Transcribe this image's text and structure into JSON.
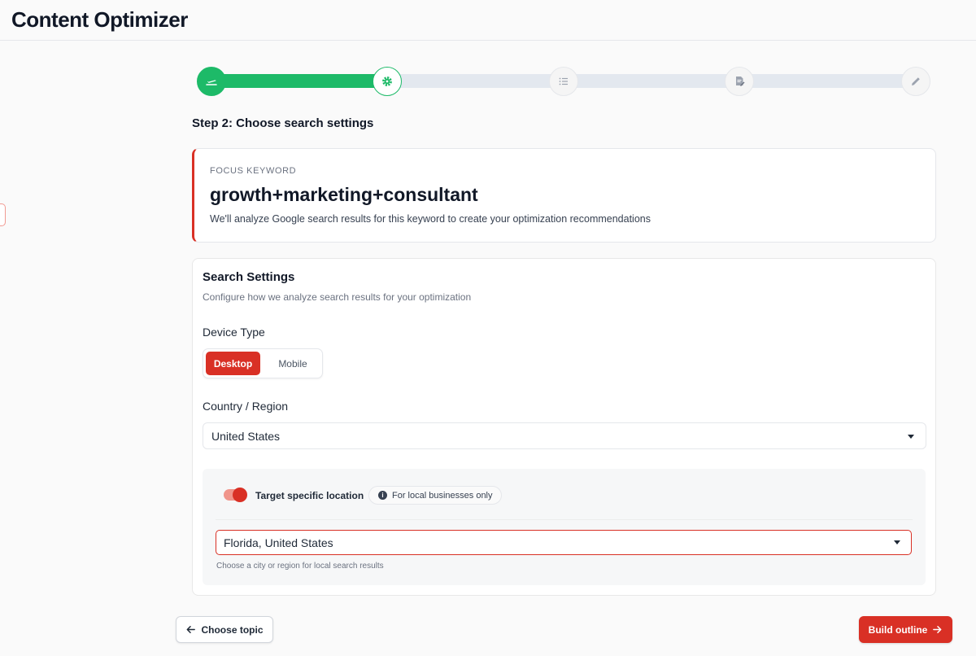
{
  "header": {
    "title": "Content Optimizer"
  },
  "stepper": {
    "steps": [
      {
        "icon": "plane-departure-icon",
        "state": "done"
      },
      {
        "icon": "gear-icon",
        "state": "active"
      },
      {
        "icon": "list-icon",
        "state": "pending"
      },
      {
        "icon": "document-edit-icon",
        "state": "pending"
      },
      {
        "icon": "pencil-icon",
        "state": "pending"
      }
    ],
    "progress_fraction": 0.25
  },
  "step_title": "Step 2: Choose search settings",
  "focus_keyword": {
    "label": "FOCUS KEYWORD",
    "value": "growth+marketing+consultant",
    "description": "We'll analyze Google search results for this keyword to create your optimization recommendations"
  },
  "search_settings": {
    "title": "Search Settings",
    "subtitle": "Configure how we analyze search results for your optimization",
    "device": {
      "label": "Device Type",
      "options": [
        "Desktop",
        "Mobile"
      ],
      "selected": "Desktop"
    },
    "country": {
      "label": "Country / Region",
      "value": "United States"
    },
    "location": {
      "toggle_label": "Target specific location",
      "toggle_on": true,
      "badge": "For local businesses only",
      "value": "Florida, United States",
      "hint": "Choose a city or region for local search results"
    }
  },
  "actions": {
    "back_label": "Choose topic",
    "next_label": "Build outline"
  },
  "colors": {
    "accent": "#d93025",
    "success": "#1dba68"
  }
}
